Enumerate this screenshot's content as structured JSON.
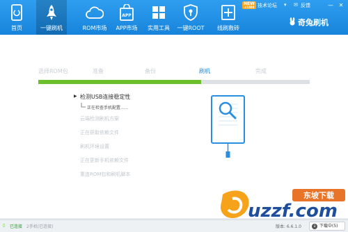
{
  "nav": {
    "home": "首页",
    "flash": "一键刷机",
    "rom_market": "ROM市场",
    "app_market": "APP市场",
    "tools": "实用工具",
    "root": "一键ROOT",
    "rescue": "线刷救砖"
  },
  "app_icon_text": "APP",
  "topbar": {
    "new_badge": "NEW",
    "new_badge_sub": "+1000",
    "forum": "技术论坛",
    "feedback": "反馈",
    "minimize": "—",
    "close": "✕",
    "logo": "奇兔刷机"
  },
  "steps": [
    "选择ROM包",
    "准备",
    "备份",
    "刷机",
    "完成"
  ],
  "current_step_index": 3,
  "progress_fraction": 0.6,
  "tasks": {
    "active": "检测USB连接稳定性",
    "substatus": "正在检查手机配置......",
    "pending": [
      "云端检测刷机方案",
      "正在获取依赖文件",
      "刷机环境设置",
      "正在更新手机依赖文件",
      "重连ROM包和刷机脚本"
    ]
  },
  "statusbar": {
    "connected": "已连接",
    "device": "2手机(已连接)",
    "version": "版本: 6.6.1.0",
    "download": "下载中(5)"
  },
  "watermark": {
    "brand": "东坡下载",
    "domain": "uzzf.com"
  },
  "colors": {
    "topbar": "#1e8fe5",
    "progress": "#6abf2a",
    "current_step": "#2588d8",
    "icon_blue": "#2a8ee0"
  }
}
